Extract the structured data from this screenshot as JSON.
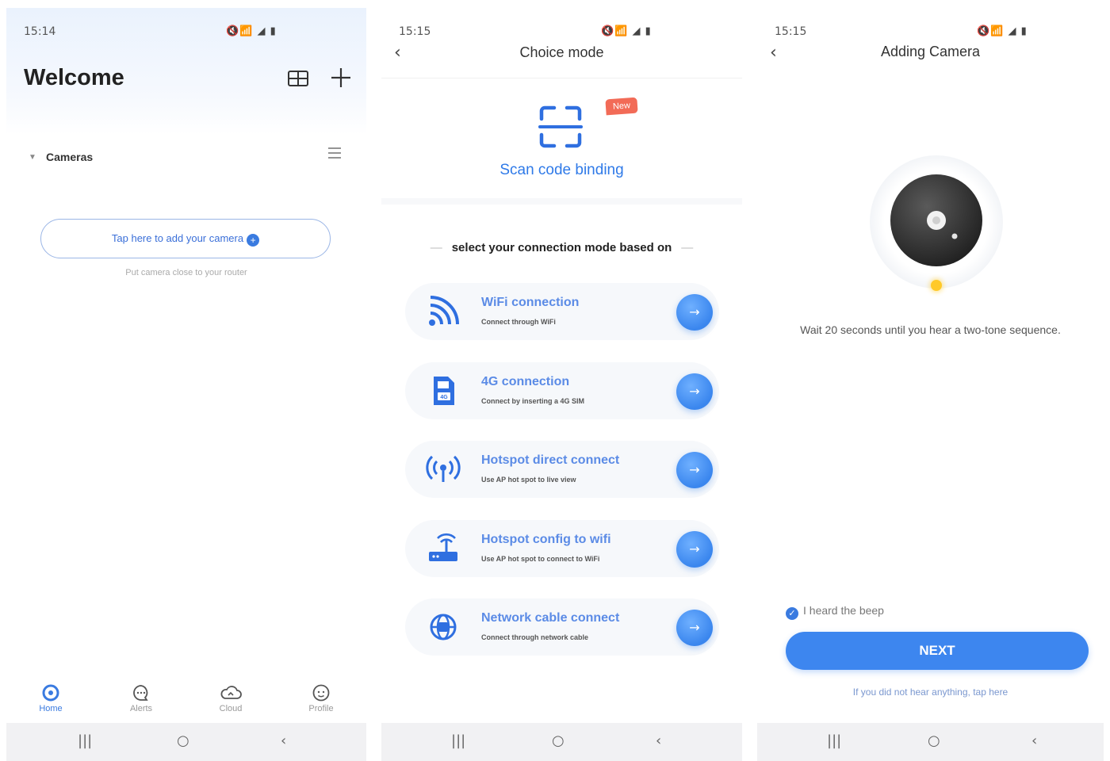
{
  "screens": {
    "home": {
      "status_time": "15:14",
      "status_icons": "🔇📶 ◢ ▮",
      "title": "Welcome",
      "section_label": "Cameras",
      "add_camera_label": "Tap here to add your camera",
      "add_camera_icon": "+",
      "hint": "Put camera close to your router",
      "tabs": [
        {
          "label": "Home",
          "icon": "home-icon"
        },
        {
          "label": "Alerts",
          "icon": "chat-icon"
        },
        {
          "label": "Cloud",
          "icon": "cloud-icon"
        },
        {
          "label": "Profile",
          "icon": "profile-icon"
        }
      ],
      "nav_buttons": {
        "recents": "|||",
        "home": "○",
        "back": "‹"
      }
    },
    "choice_mode": {
      "status_time": "15:15",
      "status_icons": "🔇📶 ◢ ▮",
      "back": "‹",
      "title": "Choice mode",
      "new_badge": "New",
      "scan_label": "Scan code binding",
      "select_label": "select your connection mode based on",
      "dash": "—",
      "options": [
        {
          "title": "WiFi connection",
          "subtitle": "Connect through WiFi",
          "icon": "wifi-signal-icon",
          "arrow": "→"
        },
        {
          "title": "4G connection",
          "subtitle": "Connect by inserting a 4G SIM",
          "icon": "sim-card-icon",
          "arrow": "→"
        },
        {
          "title": "Hotspot direct connect",
          "subtitle": "Use AP hot spot to live view",
          "icon": "hotspot-icon",
          "arrow": "→"
        },
        {
          "title": "Hotspot config to wifi",
          "subtitle": "Use AP hot spot to connect to WiFi",
          "icon": "router-icon",
          "arrow": "→"
        },
        {
          "title": "Network cable connect",
          "subtitle": "Connect through network cable",
          "icon": "network-globe-icon",
          "arrow": "→"
        }
      ],
      "nav_buttons": {
        "recents": "|||",
        "home": "○",
        "back": "‹"
      }
    },
    "adding_camera": {
      "status_time": "15:15",
      "status_icons": "🔇📶 ◢ ▮",
      "back": "‹",
      "title": "Adding Camera",
      "wait_text": "Wait 20 seconds until you hear a two-tone sequence.",
      "heard_label": "I heard the beep",
      "heard_check": "✓",
      "next_label": "NEXT",
      "not_heard_label": "If you did not hear anything, tap here",
      "nav_buttons": {
        "recents": "|||",
        "home": "○",
        "back": "‹"
      }
    }
  },
  "colors": {
    "accent": "#3a7be0",
    "badge": "#f26b57",
    "indicator": "#ffc928"
  }
}
